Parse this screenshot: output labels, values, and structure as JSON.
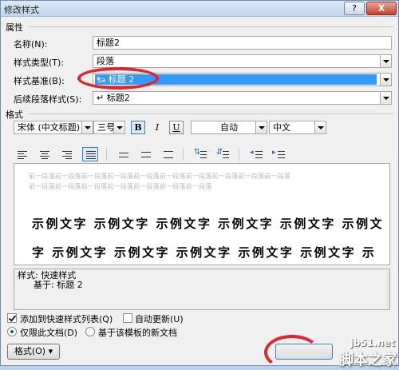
{
  "window": {
    "title": "修改样式",
    "help_label": "?",
    "close_label": "X"
  },
  "properties": {
    "section_title": "属性",
    "name_label": "名称(N):",
    "name_value": "标题2",
    "style_type_label": "样式类型(T):",
    "style_type_value": "段落",
    "based_on_label": "样式基准(B):",
    "based_on_value": "标题 2",
    "following_label": "后续段落样式(S):",
    "following_value": "标题2"
  },
  "format": {
    "section_title": "格式",
    "font_value": "宋体 (中文标题)",
    "size_value": "三号",
    "bold_label": "B",
    "italic_label": "I",
    "underline_label": "U",
    "color_value": "自动",
    "language_value": "中文"
  },
  "preview": {
    "prev_para_line1": "前一段落前一段落前一段落前一段落前一段落前一段落前一段落前一段落前一段落前一段落",
    "prev_para_line2": "前一段落前一段落前一段落前一段落前一段落前一段落前一段落",
    "sample_line1": "示例文字 示例文字 示例文字 示例文字 示例文字 示例文",
    "sample_line2": "字 示例文字 示例文字 示例文字 示例文字 示例文字 示"
  },
  "description": {
    "line1": "样式: 快速样式",
    "line2": "基于: 标题 2"
  },
  "options": {
    "add_quick_style_label": "添加到快速样式列表(Q)",
    "auto_update_label": "自动更新(U)",
    "only_this_doc_label": "仅限此文档(D)",
    "new_docs_template_label": "基于该模板的新文档"
  },
  "footer": {
    "format_button_label": "格式(O) ▾"
  },
  "watermark": {
    "url": "jb51.net",
    "site_name": "脚本之家"
  },
  "colors": {
    "selection": "#3399ff",
    "annotation": "#e0262a"
  }
}
